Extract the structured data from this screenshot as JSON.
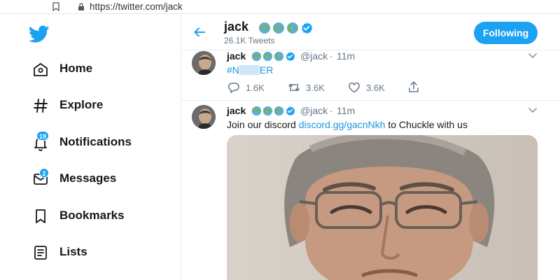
{
  "browser": {
    "url": "https://twitter.com/jack"
  },
  "sidebar": {
    "items": [
      {
        "label": "Home",
        "icon": "home-icon",
        "badge": ""
      },
      {
        "label": "Explore",
        "icon": "hashtag-icon",
        "badge": ""
      },
      {
        "label": "Notifications",
        "icon": "bell-icon",
        "badge": "19"
      },
      {
        "label": "Messages",
        "icon": "envelope-icon",
        "badge": "2"
      },
      {
        "label": "Bookmarks",
        "icon": "bookmark-icon",
        "badge": ""
      },
      {
        "label": "Lists",
        "icon": "list-icon",
        "badge": ""
      }
    ]
  },
  "header": {
    "name": "jack",
    "tweet_count": "26.1K Tweets",
    "follow_label": "Following"
  },
  "tweets": [
    {
      "name": "jack",
      "handle": "@jack",
      "separator": "·",
      "time": "11m",
      "text_prefix": "#N",
      "text_suffix": "ER",
      "replies": "1.6K",
      "retweets": "3.6K",
      "likes": "3.6K"
    },
    {
      "name": "jack",
      "handle": "@jack",
      "separator": "·",
      "time": "11m",
      "text_before": "Join our discord ",
      "link": "discord.gg/gacnNkh",
      "text_after": " to Chuckle with us"
    }
  ],
  "colors": {
    "accent": "#1da1f2",
    "link": "#1b95e0",
    "muted": "#657786",
    "verified": "#1da1f2"
  }
}
